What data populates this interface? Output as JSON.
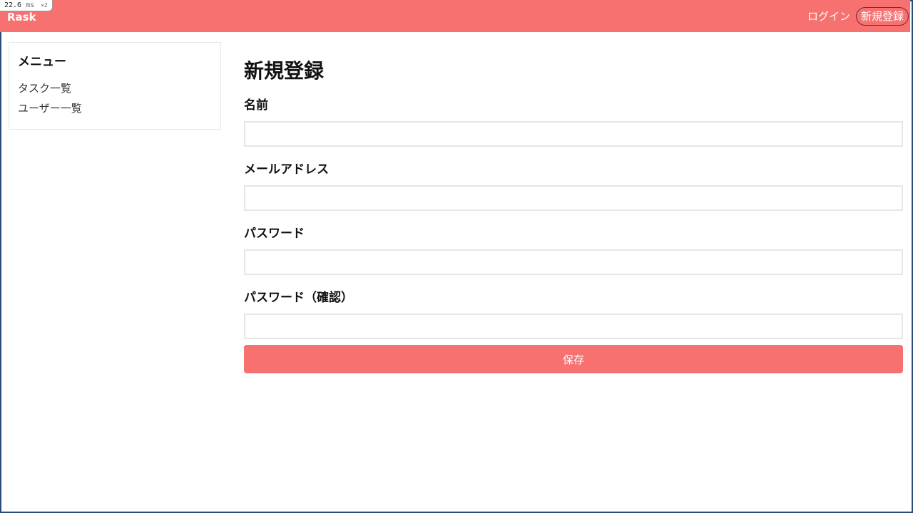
{
  "perf": {
    "value": "22.6",
    "unit": "ms",
    "multiplier": "×2"
  },
  "header": {
    "brand": "Rask",
    "nav": {
      "login": "ログイン",
      "signup": "新規登録"
    }
  },
  "sidebar": {
    "title": "メニュー",
    "items": [
      {
        "label": "タスク一覧"
      },
      {
        "label": "ユーザー一覧"
      }
    ]
  },
  "main": {
    "title": "新規登録",
    "fields": [
      {
        "label": "名前",
        "value": "",
        "placeholder": ""
      },
      {
        "label": "メールアドレス",
        "value": "",
        "placeholder": ""
      },
      {
        "label": "パスワード",
        "value": "",
        "placeholder": ""
      },
      {
        "label": "パスワード（確認）",
        "value": "",
        "placeholder": ""
      }
    ],
    "submit_label": "保存"
  },
  "colors": {
    "brand": "#f77170",
    "border": "#e6e6e6",
    "frame": "#2f4a7c"
  }
}
